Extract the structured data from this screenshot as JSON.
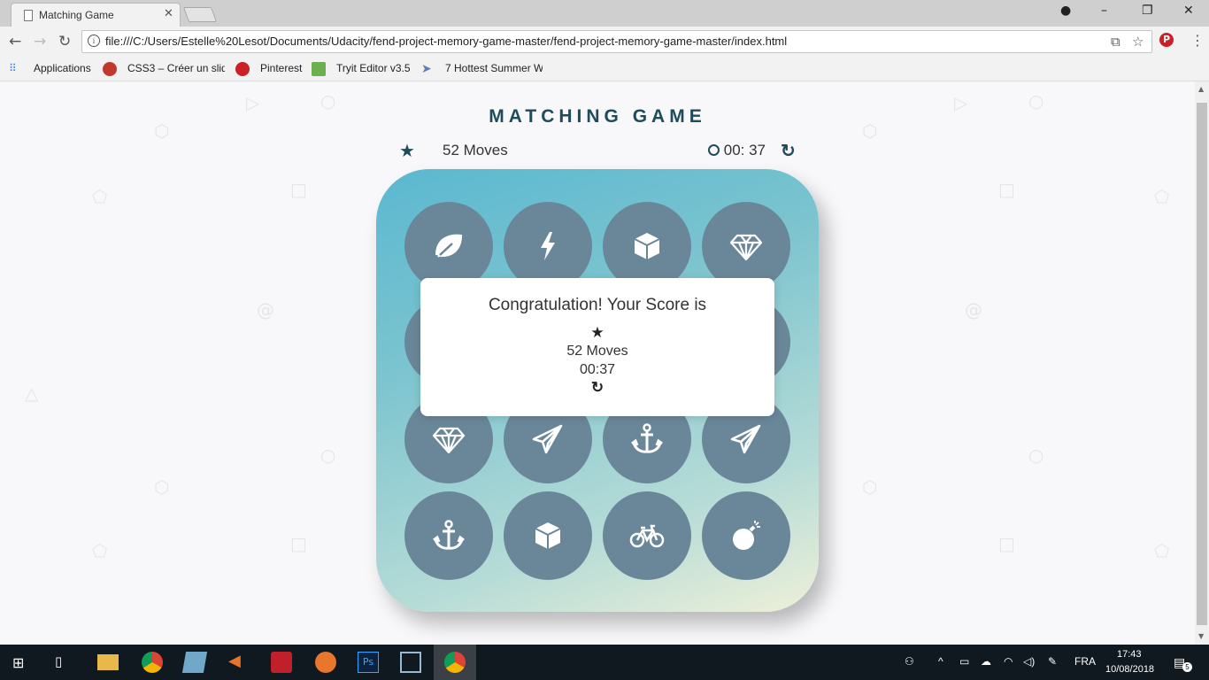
{
  "browser": {
    "tab_title": "Matching Game",
    "url": "file:///C:/Users/Estelle%20Lesot/Documents/Udacity/fend-project-memory-game-master/fend-project-memory-game-master/index.html",
    "window_controls": {
      "minimize": "–",
      "maximize": "❐",
      "close": "✕",
      "profile_icon": "profile-icon"
    },
    "bookmarks": [
      {
        "label": "Applications",
        "icon": "apps-grid-icon"
      },
      {
        "label": "CSS3 – Créer un slid",
        "icon": "css3-icon"
      },
      {
        "label": "Pinterest",
        "icon": "pinterest-icon"
      },
      {
        "label": "Tryit Editor v3.5",
        "icon": "w3-icon"
      },
      {
        "label": "7 Hottest Summer W",
        "icon": "bird-icon"
      }
    ]
  },
  "game": {
    "title": "MATCHING GAME",
    "moves": "52 Moves",
    "timer": "00: 37",
    "stars": 1,
    "cards": [
      [
        "leaf",
        "bolt",
        "cube",
        "diamond"
      ],
      [
        "hidden",
        "hidden",
        "hidden",
        "hidden"
      ],
      [
        "diamond",
        "paper-plane",
        "anchor",
        "paper-plane"
      ],
      [
        "anchor",
        "cube",
        "bicycle",
        "bomb"
      ]
    ]
  },
  "modal": {
    "title": "Congratulation! Your Score is",
    "moves": "52 Moves",
    "time": "00:37"
  },
  "taskbar": {
    "language": "FRA",
    "time": "17:43",
    "date": "10/08/2018",
    "notifications": "5"
  },
  "colors": {
    "card": "#6a8799",
    "title": "#1f4b5c",
    "deck_gradient_start": "#5ab8d0",
    "deck_gradient_end": "#eef0d8"
  }
}
